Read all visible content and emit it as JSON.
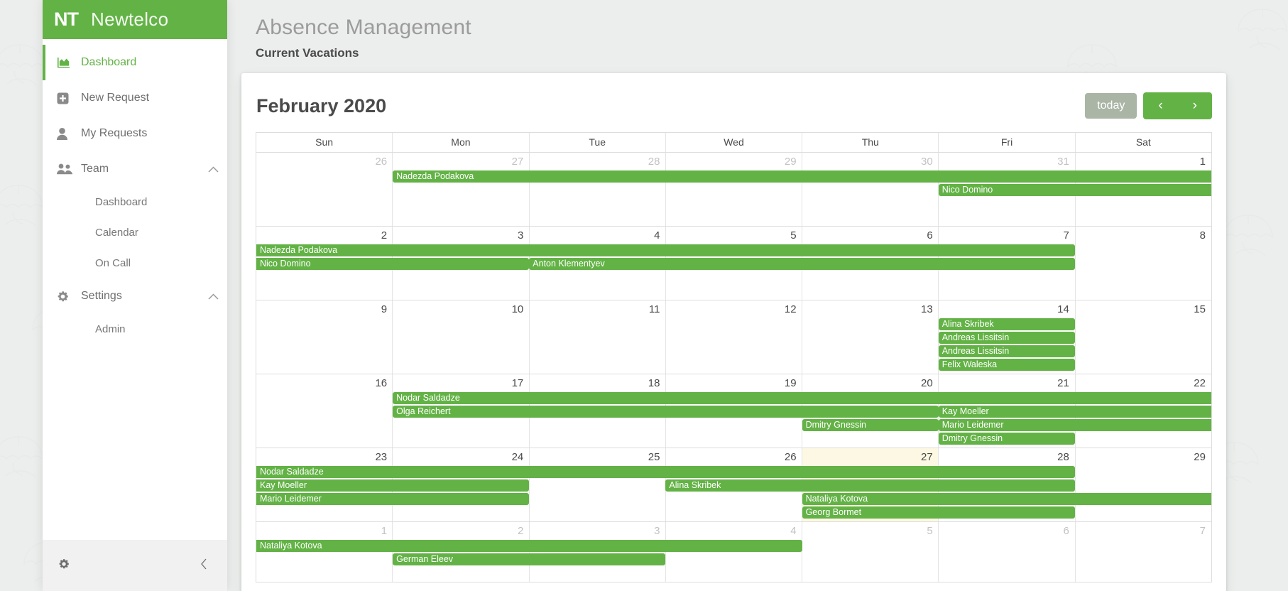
{
  "brand": {
    "mark": "NT",
    "name": "Newtelco"
  },
  "sidebar": {
    "items": [
      {
        "label": "Dashboard",
        "icon": "chart-area-icon",
        "active": true
      },
      {
        "label": "New Request",
        "icon": "plus-square-icon",
        "active": false
      },
      {
        "label": "My Requests",
        "icon": "user-icon",
        "active": false
      },
      {
        "label": "Team",
        "icon": "users-icon",
        "active": false,
        "caret": "chevron-up-icon"
      },
      {
        "label": "Settings",
        "icon": "gear-icon",
        "active": false,
        "caret": "chevron-up-icon"
      }
    ],
    "team_sub": [
      {
        "label": "Dashboard"
      },
      {
        "label": "Calendar"
      },
      {
        "label": "On Call"
      }
    ],
    "settings_sub": [
      {
        "label": "Admin"
      }
    ],
    "footer": {
      "gear": "gear-icon",
      "collapse": "chevron-left-icon"
    }
  },
  "header": {
    "title": "Absence Management",
    "subtitle": "Current Vacations"
  },
  "calendar": {
    "title": "February 2020",
    "today_label": "today",
    "prev_label": "‹",
    "next_label": "›",
    "day_headers": [
      "Sun",
      "Mon",
      "Tue",
      "Wed",
      "Thu",
      "Fri",
      "Sat"
    ],
    "accent_color": "#63b246",
    "today_bg": "#fcf8e3",
    "weeks": [
      {
        "days": [
          {
            "num": "26",
            "other": true
          },
          {
            "num": "27",
            "other": true
          },
          {
            "num": "28",
            "other": true
          },
          {
            "num": "29",
            "other": true
          },
          {
            "num": "30",
            "other": true
          },
          {
            "num": "31",
            "other": true
          },
          {
            "num": "1",
            "other": false
          }
        ],
        "rows": [
          [
            {
              "name": "Nadezda Podakova",
              "start": 1,
              "end": 7,
              "openRight": true
            }
          ],
          [
            {
              "name": "Nico Domino",
              "start": 5,
              "end": 7,
              "openRight": true
            }
          ]
        ]
      },
      {
        "days": [
          {
            "num": "2"
          },
          {
            "num": "3"
          },
          {
            "num": "4"
          },
          {
            "num": "5"
          },
          {
            "num": "6"
          },
          {
            "num": "7"
          },
          {
            "num": "8"
          }
        ],
        "rows": [
          [
            {
              "name": "Nadezda Podakova",
              "start": 0,
              "end": 6,
              "openLeft": true
            }
          ],
          [
            {
              "name": "Nico Domino",
              "start": 0,
              "end": 2,
              "openLeft": true
            },
            {
              "name": "Anton Klementyev",
              "start": 2,
              "end": 6
            }
          ]
        ]
      },
      {
        "days": [
          {
            "num": "9"
          },
          {
            "num": "10"
          },
          {
            "num": "11"
          },
          {
            "num": "12"
          },
          {
            "num": "13"
          },
          {
            "num": "14"
          },
          {
            "num": "15"
          }
        ],
        "rows": [
          [
            {
              "name": "Alina Skribek",
              "start": 5,
              "end": 6
            }
          ],
          [
            {
              "name": "Andreas Lissitsin",
              "start": 5,
              "end": 6
            }
          ],
          [
            {
              "name": "Andreas Lissitsin",
              "start": 5,
              "end": 6
            }
          ],
          [
            {
              "name": "Felix Waleska",
              "start": 5,
              "end": 6
            }
          ]
        ]
      },
      {
        "days": [
          {
            "num": "16"
          },
          {
            "num": "17"
          },
          {
            "num": "18"
          },
          {
            "num": "19"
          },
          {
            "num": "20"
          },
          {
            "num": "21"
          },
          {
            "num": "22"
          }
        ],
        "rows": [
          [
            {
              "name": "Nodar Saldadze",
              "start": 1,
              "end": 7,
              "openRight": true
            }
          ],
          [
            {
              "name": "Olga Reichert",
              "start": 1,
              "end": 5
            },
            {
              "name": "Kay Moeller",
              "start": 5,
              "end": 7,
              "openRight": true
            }
          ],
          [
            {
              "name": "Dmitry Gnessin",
              "start": 4,
              "end": 5
            },
            {
              "name": "Mario Leidemer",
              "start": 5,
              "end": 7,
              "openRight": true
            }
          ],
          [
            {
              "name": "Dmitry Gnessin",
              "start": 5,
              "end": 6
            }
          ]
        ]
      },
      {
        "days": [
          {
            "num": "23"
          },
          {
            "num": "24"
          },
          {
            "num": "25"
          },
          {
            "num": "26"
          },
          {
            "num": "27",
            "today": true
          },
          {
            "num": "28"
          },
          {
            "num": "29"
          }
        ],
        "rows": [
          [
            {
              "name": "Nodar Saldadze",
              "start": 0,
              "end": 6,
              "openLeft": true
            }
          ],
          [
            {
              "name": "Kay Moeller",
              "start": 0,
              "end": 2,
              "openLeft": true
            },
            {
              "name": "Alina Skribek",
              "start": 3,
              "end": 6
            }
          ],
          [
            {
              "name": "Mario Leidemer",
              "start": 0,
              "end": 2,
              "openLeft": true
            },
            {
              "name": "Nataliya Kotova",
              "start": 4,
              "end": 7,
              "openRight": true
            }
          ],
          [
            {
              "name": "Georg Bormet",
              "start": 4,
              "end": 6
            }
          ]
        ]
      },
      {
        "days": [
          {
            "num": "1",
            "other": true
          },
          {
            "num": "2",
            "other": true
          },
          {
            "num": "3",
            "other": true
          },
          {
            "num": "4",
            "other": true
          },
          {
            "num": "5",
            "other": true
          },
          {
            "num": "6",
            "other": true
          },
          {
            "num": "7",
            "other": true
          }
        ],
        "rows": [
          [
            {
              "name": "Nataliya Kotova",
              "start": 0,
              "end": 4,
              "openLeft": true
            }
          ],
          [
            {
              "name": "German Eleev",
              "start": 1,
              "end": 3
            }
          ]
        ]
      }
    ]
  }
}
